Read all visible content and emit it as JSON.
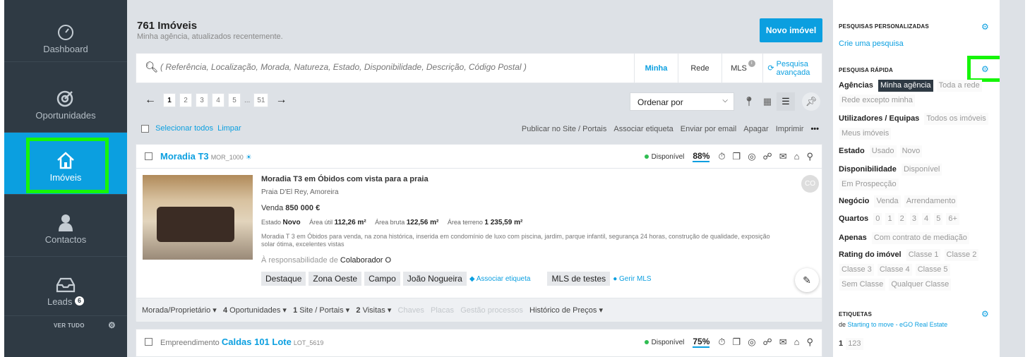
{
  "sidebar": {
    "items": [
      {
        "label": "Dashboard",
        "icon": "speedometer-icon"
      },
      {
        "label": "Oportunidades",
        "icon": "target-icon"
      },
      {
        "label": "Imóveis",
        "icon": "home-icon"
      },
      {
        "label": "Contactos",
        "icon": "person-icon"
      },
      {
        "label": "Leads",
        "icon": "inbox-icon",
        "badge": "6"
      }
    ],
    "ver_tudo": "VER TUDO",
    "active_color": "#0b9fe0",
    "bg_color": "#2f3a44"
  },
  "header": {
    "title": "761 Imóveis",
    "subtitle": "Minha agência, atualizados recentemente.",
    "new_button": "Novo imóvel"
  },
  "search": {
    "placeholder": "( Referência, Localização, Morada, Natureza, Estado, Disponibilidade, Descrição, Código Postal )",
    "tabs": [
      "Minha",
      "Rede",
      "MLS"
    ],
    "advanced": "Pesquisa avançada"
  },
  "pager": {
    "pages": [
      "1",
      "2",
      "3",
      "4",
      "5",
      "...",
      "51"
    ],
    "current": "1"
  },
  "sort": {
    "label": "Ordenar por"
  },
  "bulk": {
    "select_all": "Selecionar todos",
    "clear": "Limpar",
    "actions": [
      "Publicar no Site / Portais",
      "Associar etiqueta",
      "Enviar por email",
      "Apagar",
      "Imprimir",
      "•••"
    ]
  },
  "listing": {
    "title": "Moradia T3",
    "ref": "MOR_1000",
    "status": "Disponível",
    "score": "88%",
    "headline": "Moradia T3 em Óbidos com vista para a praia",
    "location": "Praia D'El Rey, Amoreira",
    "price_label": "Venda",
    "price": "850 000 €",
    "estado_label": "Estado",
    "estado": "Novo",
    "area_util_label": "Área útil",
    "area_util": "112,26 m²",
    "area_bruta_label": "Área bruta",
    "area_bruta": "122,56 m²",
    "area_terreno_label": "Área terreno",
    "area_terreno": "1 235,59 m²",
    "description": "Moradia T 3 em Óbidos para venda, na zona histórica, inserida em condomínio de luxo com piscina, jardim, parque infantil, segurança 24 horas, construção de qualidade, exposição solar ótima, excelentes vistas",
    "resp_label": "À responsabilidade de",
    "resp": "Colaborador O",
    "avatar": "CO",
    "tags": [
      "Destaque",
      "Zona Oeste",
      "Campo",
      "João Nogueira"
    ],
    "associar": "Associar etiqueta",
    "mls_tag": "MLS de testes",
    "gerir_mls": "Gerir MLS",
    "footer": {
      "owner": "Morada/Proprietário ▾",
      "oportunidades_n": "4",
      "oportunidades": "Oportunidades ▾",
      "portais_n": "1",
      "portais": "Site / Portais ▾",
      "visitas_n": "2",
      "visitas": "Visitas ▾",
      "chaves": "Chaves",
      "placas": "Placas",
      "gestao": "Gestão processos",
      "historico": "Histórico de Preços ▾"
    }
  },
  "listing2": {
    "type": "Empreendimento",
    "title": "Caldas 101 Lote",
    "ref": "LOT_5619",
    "status": "Disponível",
    "score": "75%"
  },
  "right_panel": {
    "custom_title": "PESQUISAS PERSONALIZADAS",
    "custom_link": "Crie uma pesquisa",
    "quick_title": "PESQUISA RÁPIDA",
    "agencias_label": "Agências",
    "agencias": [
      "Minha agência",
      "Toda a rede",
      "Rede excepto minha"
    ],
    "utilizadores_label": "Utilizadores / Equipas",
    "utilizadores": [
      "Todos os imóveis",
      "Meus imóveis"
    ],
    "estado_label": "Estado",
    "estado": [
      "Usado",
      "Novo"
    ],
    "disp_label": "Disponibilidade",
    "disp": [
      "Disponível",
      "Em Prospecção"
    ],
    "negocio_label": "Negócio",
    "negocio": [
      "Venda",
      "Arrendamento"
    ],
    "quartos_label": "Quartos",
    "quartos": [
      "0",
      "1",
      "2",
      "3",
      "4",
      "5",
      "6+"
    ],
    "apenas_label": "Apenas",
    "apenas": [
      "Com contrato de mediação"
    ],
    "rating_label": "Rating do imóvel",
    "rating": [
      "Classe 1",
      "Classe 2",
      "Classe 3",
      "Classe 4",
      "Classe 5",
      "Sem Classe",
      "Qualquer Classe"
    ],
    "etiquetas_title": "ETIQUETAS",
    "etiquetas_de": "de",
    "etiquetas_src": "Starting to move - eGO Real Estate",
    "etiquetas_items": [
      "1",
      "123"
    ]
  }
}
